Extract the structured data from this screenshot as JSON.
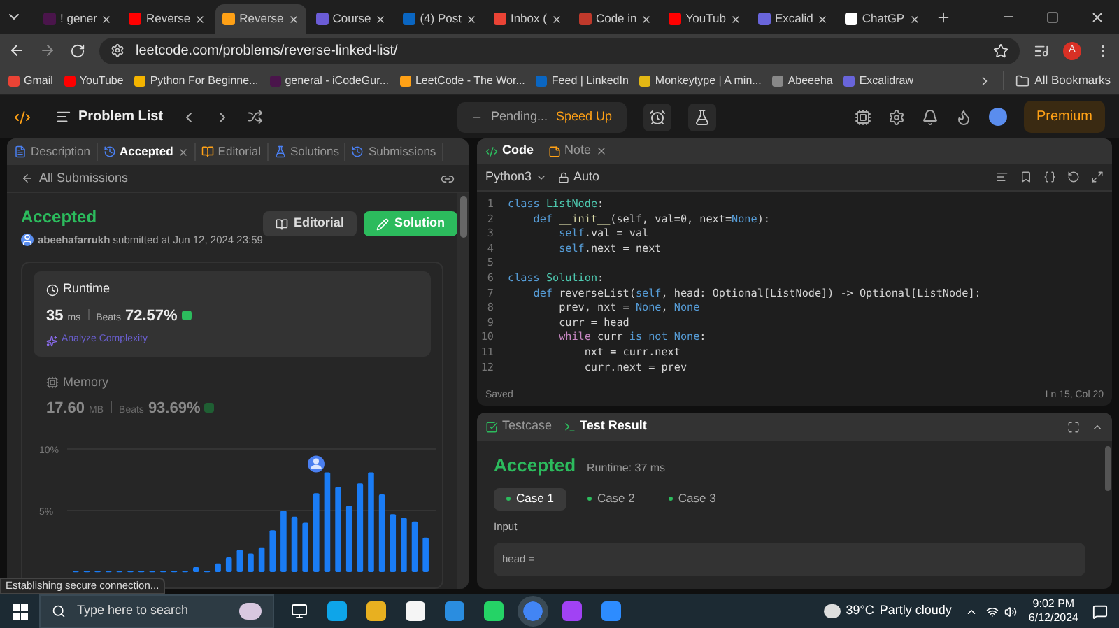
{
  "browser": {
    "tabs": [
      {
        "label": "! gener",
        "selected": false
      },
      {
        "label": "Reverse",
        "selected": false
      },
      {
        "label": "Reverse",
        "selected": true
      },
      {
        "label": "Course",
        "selected": false
      },
      {
        "label": "(4) Post",
        "selected": false
      },
      {
        "label": "Inbox (",
        "selected": false
      },
      {
        "label": "Code in",
        "selected": false
      },
      {
        "label": "YouTub",
        "selected": false
      },
      {
        "label": "Excalid",
        "selected": false
      },
      {
        "label": "ChatGP",
        "selected": false
      }
    ],
    "url": "leetcode.com/problems/reverse-linked-list/",
    "profile_initial": "A",
    "bookmarks": [
      "Gmail",
      "YouTube",
      "Python For Beginne...",
      "general - iCodeGur...",
      "LeetCode - The Wor...",
      "Feed | LinkedIn",
      "Monkeytype | A min...",
      "Abeeeha",
      "Excalidraw"
    ],
    "all_bookmarks": "All Bookmarks"
  },
  "nav": {
    "problem_list": "Problem List",
    "pending": "Pending...",
    "speed_up": "Speed Up",
    "premium": "Premium"
  },
  "left_panel": {
    "tabs": [
      {
        "label": "Description",
        "selected": false,
        "closable": false
      },
      {
        "label": "Accepted",
        "selected": true,
        "closable": true
      },
      {
        "label": "Editorial",
        "selected": false,
        "closable": false
      },
      {
        "label": "Solutions",
        "selected": false,
        "closable": false
      },
      {
        "label": "Submissions",
        "selected": false,
        "closable": false
      }
    ],
    "back_link": "All Submissions",
    "status": "Accepted",
    "submitted": "**abeehafarrukh** submitted at Jun 12, 2024 23:59",
    "buttons": [
      {
        "label": "Editorial",
        "kind": "secondary"
      },
      {
        "label": "Solution",
        "kind": "primary"
      }
    ],
    "metrics": [
      {
        "title": "Runtime",
        "value": "35",
        "unit": "ms",
        "beats_label": "Beats",
        "beats": "72.57%",
        "selected": true,
        "link": "Analyze Complexity"
      },
      {
        "title": "Memory",
        "value": "17.60",
        "unit": "MB",
        "beats_label": "Beats",
        "beats": "93.69%",
        "selected": false
      }
    ],
    "chart_data": {
      "type": "bar",
      "values": [
        0.1,
        0.1,
        0.1,
        0.1,
        0.1,
        0.1,
        0.1,
        0.1,
        0.1,
        0.1,
        0.1,
        0.4,
        0.1,
        0.7,
        1.2,
        1.8,
        1.5,
        2.0,
        3.4,
        5.0,
        4.5,
        4.0,
        6.4,
        8.1,
        6.9,
        5.4,
        7.2,
        8.1,
        6.3,
        4.7,
        4.4,
        4.1,
        2.8
      ],
      "ylim": [
        0,
        10
      ],
      "yticks": [
        {
          "value": 5,
          "label": "5%"
        },
        {
          "value": 10,
          "label": "10%"
        }
      ]
    }
  },
  "editor": {
    "tabs": [
      {
        "label": "Code",
        "selected": true,
        "closable": false
      },
      {
        "label": "Note",
        "selected": false,
        "closable": true
      }
    ],
    "language": "Python3",
    "mode": "Auto",
    "lines": [
      {
        "number": "1",
        "tokens": [
          {
            "t": "class ",
            "kind": "kw"
          },
          {
            "t": "ListNode",
            "kind": "cls"
          },
          {
            "t": ":",
            "kind": "txt"
          }
        ]
      },
      {
        "number": "2",
        "tokens": [
          {
            "t": "    def ",
            "kind": "kw"
          },
          {
            "t": "__init__",
            "kind": "fn"
          },
          {
            "t": "(self, val=0, next=",
            "kind": "txt"
          },
          {
            "t": "None",
            "kind": "kw"
          },
          {
            "t": "):",
            "kind": "txt"
          }
        ]
      },
      {
        "number": "3",
        "tokens": [
          {
            "t": "        self",
            "kind": "kw"
          },
          {
            "t": ".val = val",
            "kind": "txt"
          }
        ]
      },
      {
        "number": "4",
        "tokens": [
          {
            "t": "        self",
            "kind": "kw"
          },
          {
            "t": ".next = next",
            "kind": "txt"
          }
        ]
      },
      {
        "number": "5"
      },
      {
        "number": "6",
        "tokens": [
          {
            "t": "class ",
            "kind": "kw"
          },
          {
            "t": "Solution",
            "kind": "cls"
          },
          {
            "t": ":",
            "kind": "txt"
          }
        ]
      },
      {
        "number": "7",
        "tokens": [
          {
            "t": "    def ",
            "kind": "kw"
          },
          {
            "t": "reverseList(",
            "kind": "txt"
          },
          {
            "t": "self",
            "kind": "kw"
          },
          {
            "t": ", head: Optional[ListNode]) -> Optional[ListNode]:",
            "kind": "txt"
          }
        ]
      },
      {
        "number": "8",
        "tokens": [
          {
            "t": "        prev, nxt = ",
            "kind": "txt"
          },
          {
            "t": "None",
            "kind": "kw"
          },
          {
            "t": ", ",
            "kind": "txt"
          },
          {
            "t": "None",
            "kind": "kw"
          }
        ]
      },
      {
        "number": "9",
        "tokens": [
          {
            "t": "        curr = head",
            "kind": "txt"
          }
        ]
      },
      {
        "number": "10",
        "tokens": [
          {
            "t": "        while ",
            "kind": "ctl"
          },
          {
            "t": "curr ",
            "kind": "txt"
          },
          {
            "t": "is not None",
            "kind": "kw"
          },
          {
            "t": ":",
            "kind": "txt"
          }
        ]
      },
      {
        "number": "11",
        "tokens": [
          {
            "t": "            nxt = curr.next",
            "kind": "txt"
          }
        ]
      },
      {
        "number": "12",
        "tokens": [
          {
            "t": "            curr.next = prev",
            "kind": "txt"
          }
        ]
      }
    ],
    "saved": "Saved",
    "cursor": "Ln 15, Col 20"
  },
  "result_panel": {
    "tabs": [
      {
        "label": "Testcase",
        "selected": false
      },
      {
        "label": "Test Result",
        "selected": true
      }
    ],
    "status": "Accepted",
    "runtime": "Runtime: 37 ms",
    "cases": [
      {
        "label": "Case 1",
        "selected": true
      },
      {
        "label": "Case 2",
        "selected": false
      },
      {
        "label": "Case 3",
        "selected": false
      }
    ],
    "input_label": "Input",
    "input_value": "head ="
  },
  "status_bubble": "Establishing secure connection...",
  "taskbar": {
    "search_placeholder": "Type here to search",
    "temperature": "39°C",
    "weather": "Partly cloudy",
    "time": "9:02 PM",
    "date": "6/12/2024"
  }
}
